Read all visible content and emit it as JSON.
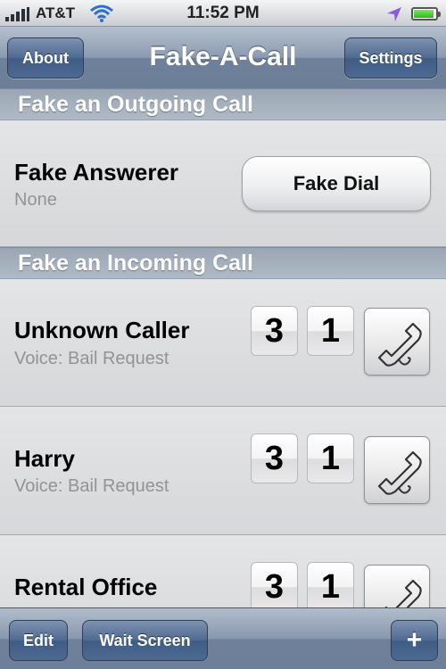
{
  "status_bar": {
    "carrier": "AT&T",
    "time": "11:52 PM",
    "battery_level": 0.9
  },
  "nav": {
    "title": "Fake-A-Call",
    "left_button": "About",
    "right_button": "Settings"
  },
  "outgoing": {
    "header": "Fake an Outgoing Call",
    "title": "Fake Answerer",
    "subtitle": "None",
    "button": "Fake Dial"
  },
  "incoming": {
    "header": "Fake an Incoming Call",
    "calls": [
      {
        "name": "Unknown Caller",
        "voice": "Voice: Bail Request",
        "digit1": "3",
        "digit2": "1"
      },
      {
        "name": "Harry",
        "voice": "Voice: Bail Request",
        "digit1": "3",
        "digit2": "1"
      },
      {
        "name": "Rental Office",
        "voice": "",
        "digit1": "3",
        "digit2": "1"
      }
    ]
  },
  "toolbar": {
    "edit": "Edit",
    "wait_screen": "Wait Screen",
    "add": "+"
  },
  "icons": {
    "call": "phone-handset-icon",
    "wifi": "wifi-icon",
    "location": "location-arrow-icon",
    "battery": "battery-icon",
    "signal": "signal-bars-icon"
  },
  "colors": {
    "nav_bar": "#7a8ba3",
    "button_blue": "#4d6a93",
    "section_header": "#a4afbd",
    "subtitle_gray": "#939393",
    "location_purple": "#8a5cd6",
    "battery_green": "#32b51a"
  }
}
